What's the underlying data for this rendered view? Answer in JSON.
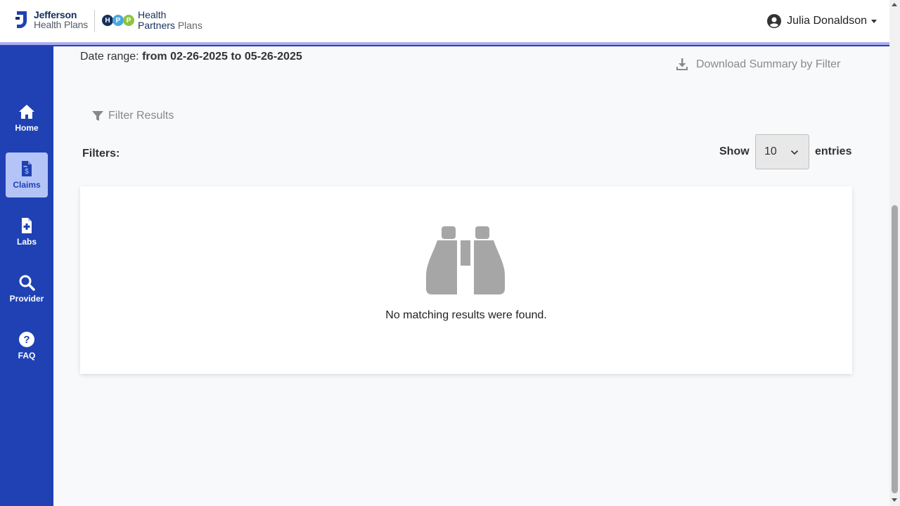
{
  "header": {
    "logo_primary": {
      "line1": "Jefferson",
      "line2": "Health Plans"
    },
    "logo_secondary": {
      "badge_letters": [
        "H",
        "P",
        "P"
      ],
      "line1": "Health",
      "line2_a": "Partners",
      "line2_b": "Plans"
    },
    "user_name": "Julia Donaldson"
  },
  "sidebar": {
    "items": [
      {
        "label": "Home",
        "icon": "home-icon",
        "active": false
      },
      {
        "label": "Claims",
        "icon": "claims-document-icon",
        "active": true
      },
      {
        "label": "Labs",
        "icon": "labs-document-icon",
        "active": false
      },
      {
        "label": "Provider",
        "icon": "search-icon",
        "active": false
      },
      {
        "label": "FAQ",
        "icon": "question-circle-icon",
        "active": false
      }
    ]
  },
  "main": {
    "date_range_label": "Date range:",
    "date_range_value": "from 02-26-2025 to 05-26-2025",
    "download_label": "Download Summary by Filter",
    "filter_results_label": "Filter Results",
    "filters_label": "Filters:",
    "show_label": "Show",
    "entries_value": "10",
    "entries_label": "entries",
    "empty_message": "No matching results were found."
  },
  "colors": {
    "sidebar": "#1f41b4",
    "sidebar_active": "#b4c4f7",
    "header_accent": "#a9b0ee",
    "muted_text": "#888888",
    "icon_gray": "#a6a6a6"
  }
}
